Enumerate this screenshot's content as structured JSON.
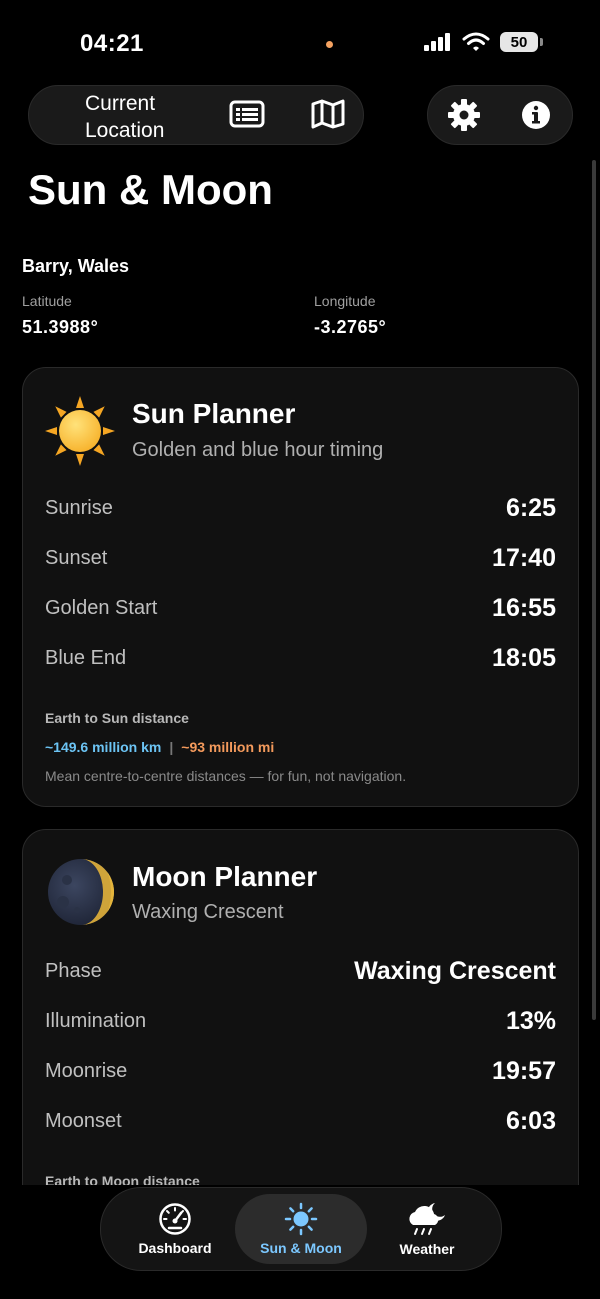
{
  "status": {
    "time": "04:21",
    "battery": "50"
  },
  "top_bar": {
    "location_button": "Current\nLocation"
  },
  "page": {
    "title": "Sun & Moon"
  },
  "location": {
    "name": "Barry, Wales",
    "latitude_label": "Latitude",
    "latitude": "51.3988°",
    "longitude_label": "Longitude",
    "longitude": "-3.2765°"
  },
  "sun": {
    "title": "Sun Planner",
    "subtitle": "Golden and blue hour timing",
    "rows": [
      {
        "label": "Sunrise",
        "value": "6:25"
      },
      {
        "label": "Sunset",
        "value": "17:40"
      },
      {
        "label": "Golden Start",
        "value": "16:55"
      },
      {
        "label": "Blue End",
        "value": "18:05"
      }
    ],
    "distance_heading": "Earth to Sun distance",
    "distance_km": "~149.6 million km",
    "distance_sep": "|",
    "distance_mi": "~93 million mi",
    "note": "Mean centre-to-centre distances — for fun, not navigation."
  },
  "moon": {
    "title": "Moon Planner",
    "subtitle": "Waxing Crescent",
    "rows": [
      {
        "label": "Phase",
        "value": "Waxing Crescent"
      },
      {
        "label": "Illumination",
        "value": "13%"
      },
      {
        "label": "Moonrise",
        "value": "19:57"
      },
      {
        "label": "Moonset",
        "value": "6:03"
      }
    ],
    "distance_heading": "Earth to Moon distance"
  },
  "tabs": [
    {
      "label": "Dashboard",
      "icon": "speedometer-icon"
    },
    {
      "label": "Sun & Moon",
      "icon": "sun-icon"
    },
    {
      "label": "Weather",
      "icon": "cloud-moon-rain-icon"
    }
  ],
  "colors": {
    "accent": "#7cc8ff",
    "km": "#6cc4f4",
    "mi": "#f49a5c"
  }
}
